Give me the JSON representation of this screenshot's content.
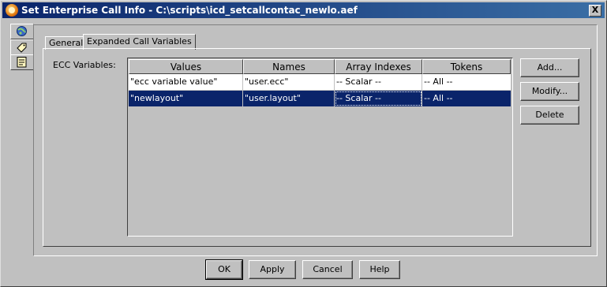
{
  "window": {
    "title": "Set Enterprise Call Info - C:\\scripts\\icd_setcallcontac_newlo.aef",
    "close_glyph": "X"
  },
  "side_icons": [
    "globe-icon",
    "tag-icon",
    "notepad-icon"
  ],
  "tabs": [
    {
      "label": "General",
      "active": false
    },
    {
      "label": "Expanded Call Variables",
      "active": true
    }
  ],
  "ecc": {
    "label": "ECC Variables:",
    "columns": [
      "Values",
      "Names",
      "Array Indexes",
      "Tokens"
    ],
    "rows": [
      {
        "value": "\"ecc variable value\"",
        "name": "\"user.ecc\"",
        "index": "-- Scalar --",
        "token": "-- All --",
        "selected": false
      },
      {
        "value": "\"newlayout\"",
        "name": "\"user.layout\"",
        "index": "-- Scalar --",
        "token": "-- All --",
        "selected": true
      }
    ]
  },
  "side_buttons": {
    "add": "Add...",
    "modify": "Modify...",
    "delete": "Delete"
  },
  "footer": {
    "ok": "OK",
    "apply": "Apply",
    "cancel": "Cancel",
    "help": "Help"
  },
  "colors": {
    "titlebar": "#0a246a",
    "selection": "#0a246a",
    "face": "#c0c0c0"
  }
}
